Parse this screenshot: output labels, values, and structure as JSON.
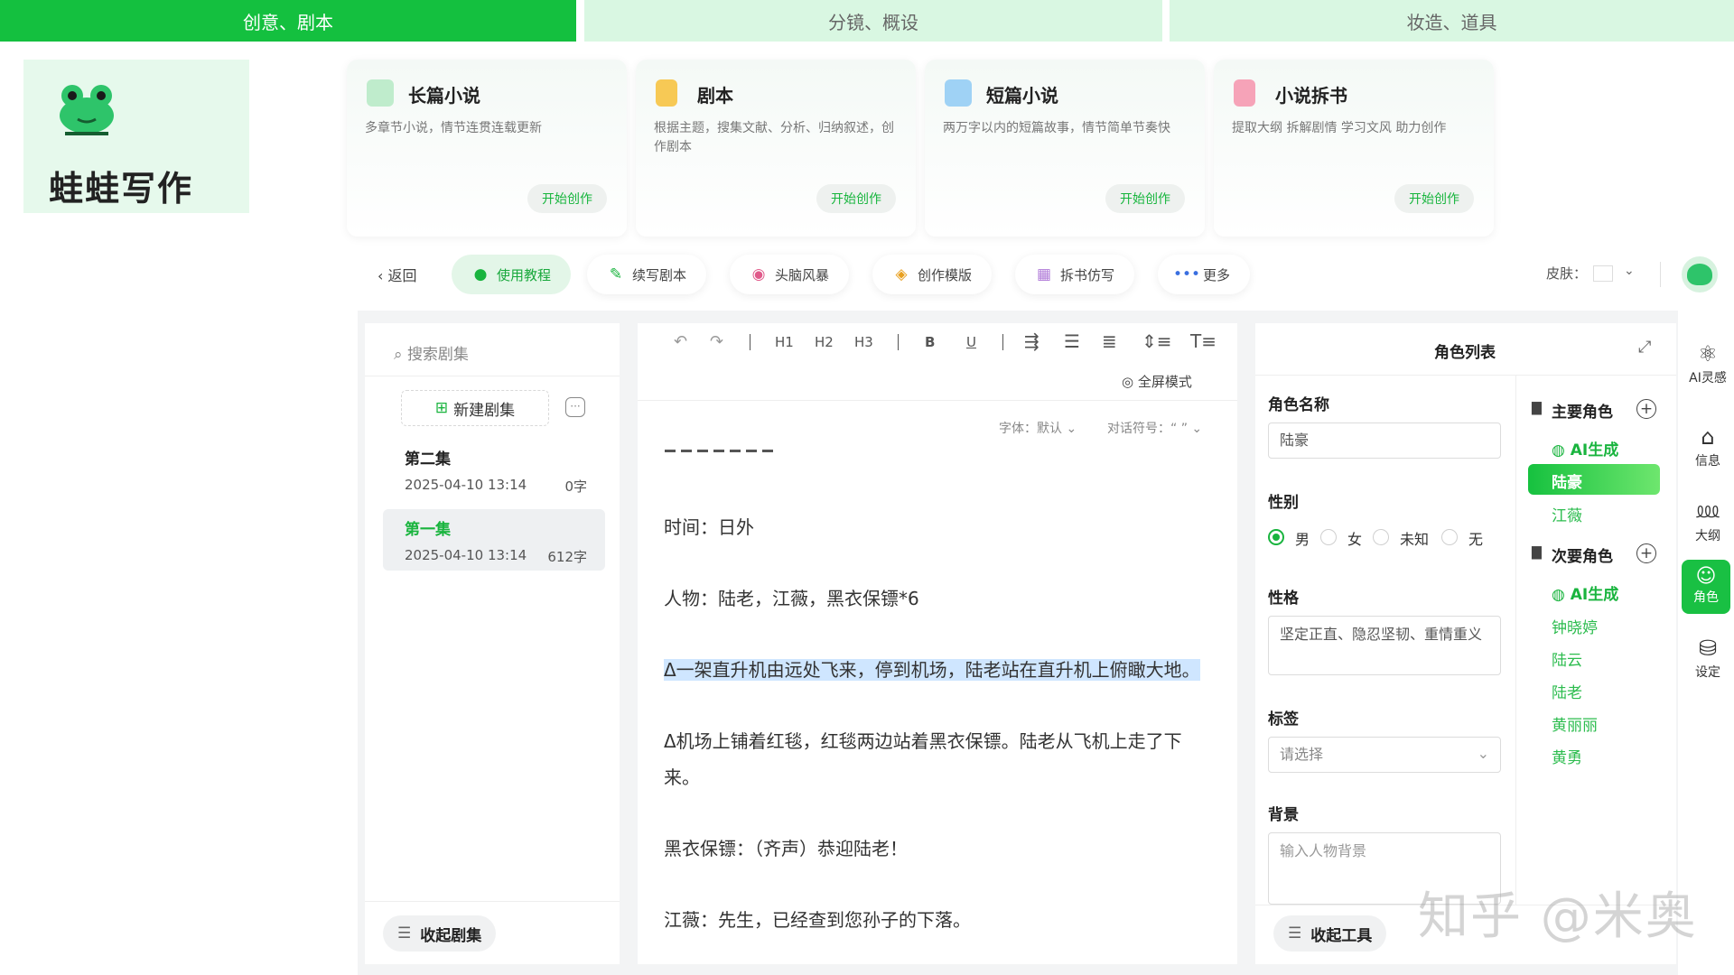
{
  "top_tabs": [
    "创意、剧本",
    "分镜、概设",
    "妆造、道具"
  ],
  "brand": {
    "name": "蛙蛙写作"
  },
  "cards": [
    {
      "title": "长篇小说",
      "desc": "多章节小说，情节连贯连载更新",
      "btn": "开始创作"
    },
    {
      "title": "剧本",
      "desc": "根据主题，搜集文献、分析、归纳叙述，创作剧本",
      "btn": "开始创作"
    },
    {
      "title": "短篇小说",
      "desc": "两万字以内的短篇故事，情节简单节奏快",
      "btn": "开始创作"
    },
    {
      "title": "小说拆书",
      "desc": "提取大纲 拆解剧情 学习文风 助力创作",
      "btn": "开始创作"
    }
  ],
  "toolbar": {
    "back": "返回",
    "chips": [
      "使用教程",
      "续写剧本",
      "头脑风暴",
      "创作模版",
      "拆书仿写",
      "更多"
    ],
    "skin_label": "皮肤："
  },
  "episodes": {
    "search_placeholder": "搜索剧集",
    "new_label": "新建剧集",
    "items": [
      {
        "title": "第二集",
        "date": "2025-04-10 13:14",
        "count": "0字"
      },
      {
        "title": "第一集",
        "date": "2025-04-10 13:14",
        "count": "612字"
      }
    ],
    "collapse": "收起剧集"
  },
  "editor": {
    "headings": [
      "H1",
      "H2",
      "H3"
    ],
    "bold": "B",
    "underline": "U",
    "fullscreen": "全屏模式",
    "font_label": "字体：默认",
    "dialog_label": "对话符号：“ ”",
    "paragraphs": [
      "时间：日外",
      "人物：陆老，江薇，黑衣保镖*6",
      "Δ一架直升机由远处飞来，停到机场，陆老站在直升机上俯瞰大地。",
      "Δ机场上铺着红毯，红毯两边站着黑衣保镖。陆老从飞机上走了下",
      "来。",
      "黑衣保镖：（齐声）恭迎陆老！",
      "江薇：先生，已经查到您孙子的下落。"
    ]
  },
  "roles": {
    "header": "角色列表",
    "name_label": "角色名称",
    "name_value": "陆豪",
    "gender_label": "性别",
    "genders": [
      "男",
      "女",
      "未知",
      "无"
    ],
    "personality_label": "性格",
    "personality_value": "坚定正直、隐忍坚韧、重情重义",
    "tag_label": "标签",
    "tag_placeholder": "请选择",
    "background_label": "背景",
    "background_placeholder": "输入人物背景",
    "main_group": "主要角色",
    "secondary_group": "次要角色",
    "ai_generate": "AI生成",
    "main_roles": [
      "陆豪",
      "江薇"
    ],
    "secondary_roles": [
      "钟晓婷",
      "陆云",
      "陆老",
      "黄丽丽",
      "黄勇"
    ],
    "collapse": "收起工具"
  },
  "sidebar": [
    "AI灵感",
    "信息",
    "大纲",
    "角色",
    "设定"
  ],
  "watermark": "知乎 @米奥",
  "colors": {
    "accent": "#14c03f",
    "accent_light": "#d9f7e2",
    "highlight": "#cfe6ff"
  }
}
